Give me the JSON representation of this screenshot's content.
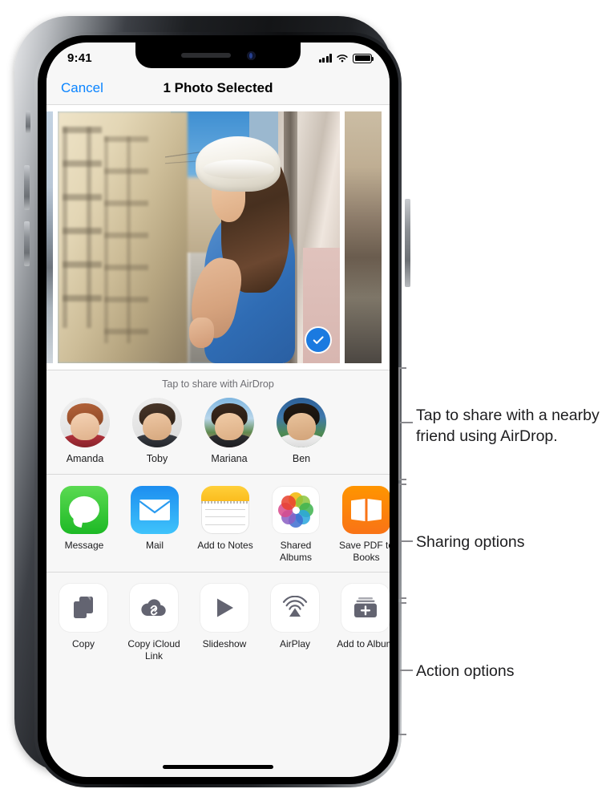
{
  "status_bar": {
    "time": "9:41",
    "cellular_icon": "signal-bars-icon",
    "wifi_icon": "wifi-icon",
    "battery_icon": "battery-full-icon"
  },
  "nav_bar": {
    "cancel_label": "Cancel",
    "title": "1 Photo Selected"
  },
  "photo_preview": {
    "description": "Woman in blue dress and white sun hat leaning on a balcony above a European street",
    "selected_badge_icon": "checkmark-circle-icon",
    "selected": true
  },
  "airdrop": {
    "hint": "Tap to share with AirDrop",
    "people": [
      {
        "name": "Amanda"
      },
      {
        "name": "Toby"
      },
      {
        "name": "Mariana"
      },
      {
        "name": "Ben"
      }
    ]
  },
  "share_apps": [
    {
      "label": "Message",
      "icon": "messages-app-icon"
    },
    {
      "label": "Mail",
      "icon": "mail-app-icon"
    },
    {
      "label": "Add to Notes",
      "icon": "notes-app-icon"
    },
    {
      "label": "Shared Albums",
      "icon": "photos-app-icon"
    },
    {
      "label": "Save PDF to Books",
      "icon": "books-app-icon"
    }
  ],
  "actions": [
    {
      "label": "Copy",
      "icon": "copy-icon"
    },
    {
      "label": "Copy iCloud Link",
      "icon": "icloud-link-icon"
    },
    {
      "label": "Slideshow",
      "icon": "play-triangle-icon"
    },
    {
      "label": "AirPlay",
      "icon": "airplay-icon"
    },
    {
      "label": "Add to Album",
      "icon": "add-to-album-icon"
    }
  ],
  "callouts": [
    {
      "text": "Tap to share with a nearby friend using AirDrop."
    },
    {
      "text": "Sharing options"
    },
    {
      "text": "Action options"
    }
  ],
  "colors": {
    "accent_blue": "#0a84ff",
    "badge_blue": "#1b7ae0",
    "sheet_bg": "#f7f7f7",
    "callout_line": "#8a8a8e"
  }
}
